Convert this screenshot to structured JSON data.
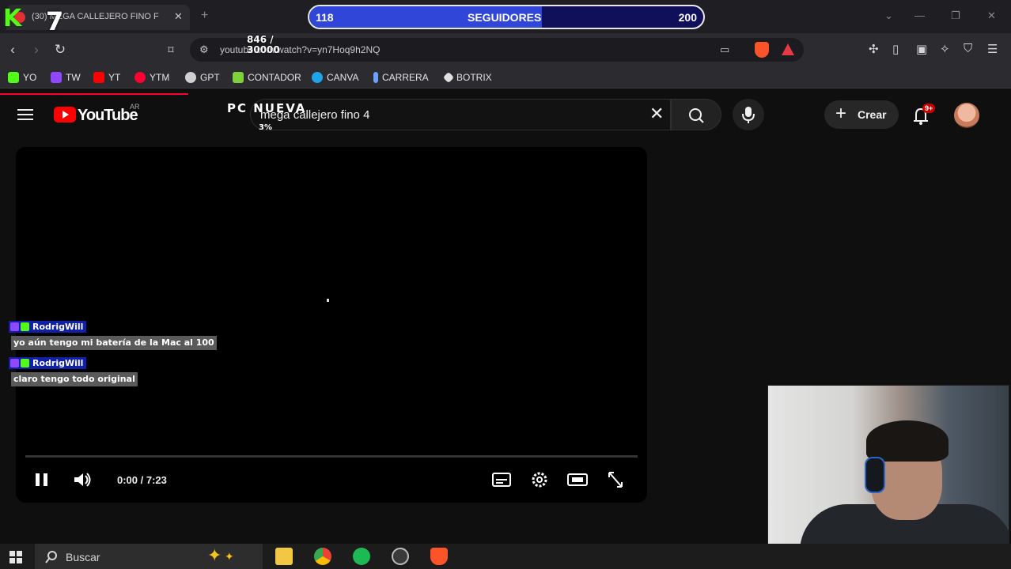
{
  "browser": {
    "tab_title": "(30) MEGA CALLEJERO FINO F",
    "url": "youtube.com/watch?v=yn7Hoq9h2NQ",
    "bookmarks": [
      {
        "label": "YO",
        "color": "#53fc18"
      },
      {
        "label": "TW",
        "color": "#9146ff"
      },
      {
        "label": "YT",
        "color": "#ff0000"
      },
      {
        "label": "YTM",
        "color": "#ff0033"
      },
      {
        "label": "GPT",
        "color": "#d0d0d0"
      },
      {
        "label": "CONTADOR",
        "color": "#7fd13b"
      },
      {
        "label": "CANVA",
        "color": "#20a4e8"
      },
      {
        "label": "CARRERA",
        "color": "#6aa3ff"
      },
      {
        "label": "BOTRIX",
        "color": "#e0e0e0"
      }
    ]
  },
  "overlay": {
    "logo_letter": "K",
    "logo_number": "7",
    "goal": {
      "current": "118",
      "label": "SEGUIDORES",
      "target": "200",
      "progress": 0.59
    },
    "stats_line1": "846 /",
    "stats_line2": "30000",
    "pc_label": "PC NUEVA",
    "pc_pct": "3%"
  },
  "youtube": {
    "logo_text": "YouTube",
    "region": "AR",
    "search_value": "mega callejero fino 4",
    "create_label": "Crear",
    "notif_badge": "9+"
  },
  "player": {
    "time": "0:00 / 7:23"
  },
  "chat": [
    {
      "user": "RodrigWill",
      "message": "yo aún tengo mi batería de la Mac al 100"
    },
    {
      "user": "RodrigWill",
      "message": "claro tengo todo original"
    }
  ],
  "taskbar": {
    "search_label": "Buscar"
  }
}
